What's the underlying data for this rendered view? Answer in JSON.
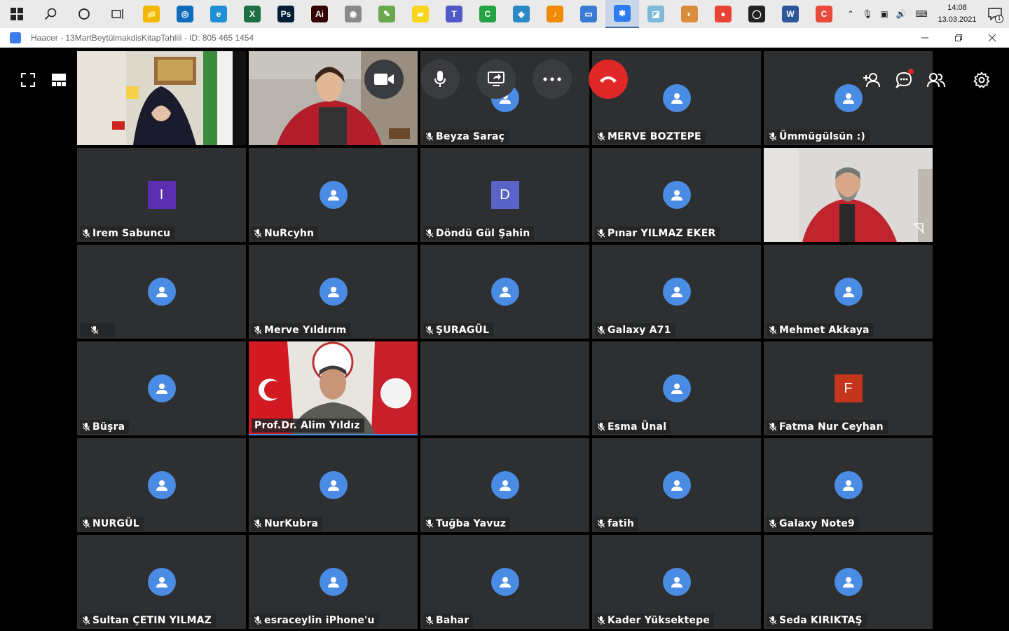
{
  "taskbar": {
    "apps": [
      {
        "icon": "file-explorer-icon",
        "color": "#f2b800",
        "glyph": "📁"
      },
      {
        "icon": "outlook-icon",
        "color": "#0f6cbd",
        "glyph": "◎"
      },
      {
        "icon": "edge-icon",
        "color": "#1f8fd6",
        "glyph": "e"
      },
      {
        "icon": "excel-icon",
        "color": "#1d7044",
        "glyph": "X"
      },
      {
        "icon": "photoshop-icon",
        "color": "#001e36",
        "glyph": "Ps"
      },
      {
        "icon": "illustrator-icon",
        "color": "#330000",
        "glyph": "Ai"
      },
      {
        "icon": "app-icon-7",
        "color": "#8a8a8a",
        "glyph": "◉"
      },
      {
        "icon": "app-icon-8",
        "color": "#6aa84f",
        "glyph": "✎"
      },
      {
        "icon": "sticky-notes-icon",
        "color": "#f7d51d",
        "glyph": "▰"
      },
      {
        "icon": "teams-icon",
        "color": "#5059c9",
        "glyph": "T"
      },
      {
        "icon": "camtasia-icon",
        "color": "#25a244",
        "glyph": "C"
      },
      {
        "icon": "app-icon-12",
        "color": "#2b8ac6",
        "glyph": "◈"
      },
      {
        "icon": "fl-studio-icon",
        "color": "#f08a00",
        "glyph": "♪"
      },
      {
        "icon": "remote-desktop-icon",
        "color": "#3a7bd5",
        "glyph": "▭"
      },
      {
        "icon": "zoom-meeting-icon",
        "color": "#2d7bf0",
        "glyph": "✱"
      },
      {
        "icon": "app-icon-16",
        "color": "#7db9d8",
        "glyph": "◪"
      },
      {
        "icon": "paint-icon",
        "color": "#d98c3c",
        "glyph": "◐"
      },
      {
        "icon": "chrome-icon",
        "color": "#e94335",
        "glyph": "●"
      },
      {
        "icon": "obs-icon",
        "color": "#222222",
        "glyph": "◯"
      },
      {
        "icon": "word-icon",
        "color": "#2b579a",
        "glyph": "W"
      },
      {
        "icon": "app-icon-21",
        "color": "#e84a3b",
        "glyph": "C"
      }
    ],
    "clock_time": "14:08",
    "clock_date": "13.03.2021",
    "notification_count": "1"
  },
  "window": {
    "title": "Haacer - 13MartBeytülmakdisKitapTahlili - ID: 805 465 1454"
  },
  "participants": [
    {
      "name": "",
      "type": "video",
      "scene": "woman"
    },
    {
      "name": "",
      "type": "video",
      "scene": "woman2"
    },
    {
      "name": "Beyza Saraç",
      "type": "avatar"
    },
    {
      "name": "MERVE BOZTEPE",
      "type": "avatar"
    },
    {
      "name": "Ümmügülsün :)",
      "type": "avatar"
    },
    {
      "name": "Irem Sabuncu",
      "type": "letter",
      "letter": "I",
      "color": "#5b2fb0"
    },
    {
      "name": "NuRcyhn",
      "type": "avatar"
    },
    {
      "name": "Döndü Gül Şahin",
      "type": "letter",
      "letter": "D",
      "color": "#5a64c8"
    },
    {
      "name": "Pınar YILMAZ EKER",
      "type": "avatar"
    },
    {
      "name": "",
      "type": "video",
      "scene": "man"
    },
    {
      "name": "",
      "type": "avatar"
    },
    {
      "name": "Merve Yıldırım",
      "type": "avatar"
    },
    {
      "name": "ŞURAGÜL",
      "type": "avatar"
    },
    {
      "name": "Galaxy A71",
      "type": "avatar"
    },
    {
      "name": "Mehmet Akkaya",
      "type": "avatar"
    },
    {
      "name": "Büşra",
      "type": "avatar"
    },
    {
      "name": "Prof.Dr. Alim Yıldız",
      "type": "video",
      "scene": "prof"
    },
    {
      "name": "",
      "type": "empty"
    },
    {
      "name": "Esma Ünal",
      "type": "avatar"
    },
    {
      "name": "Fatma Nur Ceyhan",
      "type": "letter",
      "letter": "F",
      "color": "#c4361b"
    },
    {
      "name": "NURGÜL",
      "type": "avatar"
    },
    {
      "name": "NurKubra",
      "type": "avatar"
    },
    {
      "name": "Tuğba Yavuz",
      "type": "avatar"
    },
    {
      "name": "fatih",
      "type": "avatar"
    },
    {
      "name": "Galaxy Note9",
      "type": "avatar"
    },
    {
      "name": "Sultan ÇETIN YILMAZ",
      "type": "avatar"
    },
    {
      "name": "esraceylin iPhone'u",
      "type": "avatar"
    },
    {
      "name": "Bahar",
      "type": "avatar"
    },
    {
      "name": "Kader Yüksektepe",
      "type": "avatar"
    },
    {
      "name": "Seda KIRIKTAŞ",
      "type": "avatar"
    }
  ],
  "colors": {
    "tile_bg": "#2d2f31",
    "avatar": "#4a8be4",
    "hangup": "#e02828",
    "active_speaker_border": "#4a8be4"
  }
}
